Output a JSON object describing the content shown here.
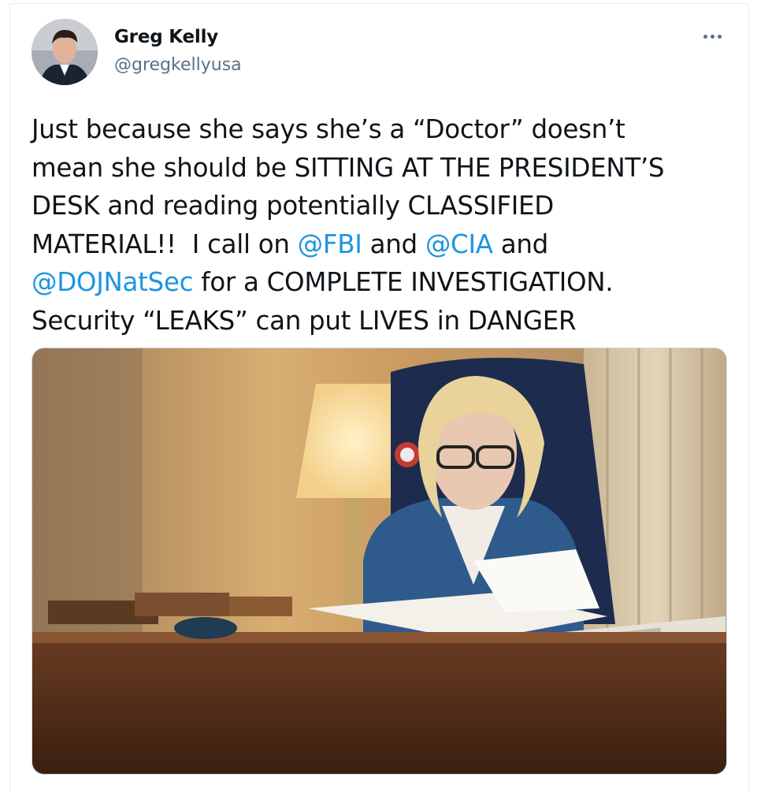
{
  "tweet": {
    "author": {
      "name": "Greg Kelly",
      "handle": "@gregkellyusa"
    },
    "text": {
      "line1": "Just because she says she’s a “Doctor” doesn’t",
      "line2": "mean she should be SITTING AT THE PRESIDENT’S",
      "line3": "DESK and reading potentially CLASSIFIED",
      "line4_prefix": "MATERIAL!!  I call on ",
      "mention_fbi": "@FBI",
      "and1": " and ",
      "mention_cia": "@CIA",
      "and2": " and",
      "mention_doj": "@DOJNatSec",
      "line5_suffix": " for a COMPLETE INVESTIGATION.",
      "line6": "Security “LEAKS” can put LIVES in DANGER"
    },
    "more_icon": "ellipsis-icon",
    "colors": {
      "mention": "#1b95e0",
      "secondary_text": "#5b7083"
    }
  }
}
